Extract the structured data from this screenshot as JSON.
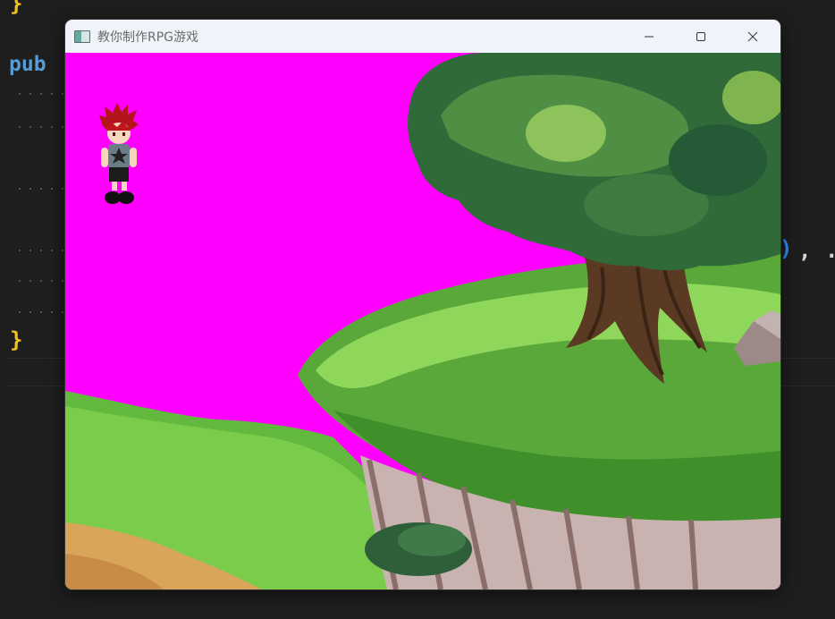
{
  "editor": {
    "brace_top": "}",
    "keyword_pub": "pub",
    "brace_bottom": "}",
    "paren": ")",
    "comma": ",",
    "dot": "."
  },
  "window": {
    "title": "教你制作RPG游戏",
    "controls": {
      "minimize_icon": "minimize-icon",
      "maximize_icon": "maximize-icon",
      "close_icon": "close-icon"
    }
  },
  "colors": {
    "editor_background": "#1e1e1e",
    "titlebar_background": "#f0f3f9",
    "transparency_key_background": "#ff00ff",
    "grass_light": "#7fd14a",
    "grass_dark": "#3f8f2b",
    "tree_foliage": "#3f7f3a",
    "tree_trunk": "#5a3a22",
    "cliff_rock": "#c9b3b0",
    "dirt_path": "#d9a55b"
  },
  "scene": {
    "sprites": [
      "player-character",
      "large-tree",
      "grass-cliff",
      "rock",
      "small-bush",
      "dirt-path"
    ]
  }
}
